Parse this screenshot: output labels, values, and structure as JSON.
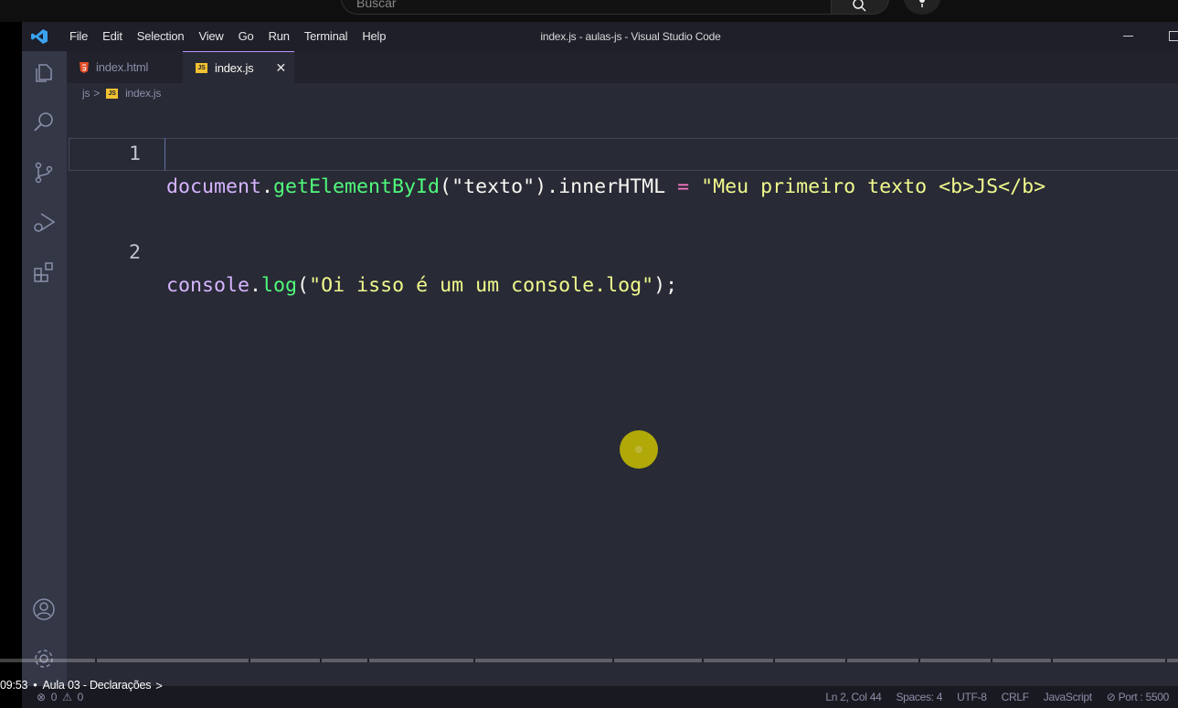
{
  "youtube": {
    "search_placeholder": "Buscar",
    "chapter_time": "09:53",
    "chapter_bullet": "•",
    "chapter_title": "Aula 03 - Declarações",
    "chapter_chevron": ">"
  },
  "window": {
    "title": "index.js - aulas-js - Visual Studio Code"
  },
  "menu": [
    "File",
    "Edit",
    "Selection",
    "View",
    "Go",
    "Run",
    "Terminal",
    "Help"
  ],
  "tabs": [
    {
      "label": "index.html",
      "icon": "html5-icon",
      "active": false
    },
    {
      "label": "index.js",
      "icon": "js-icon",
      "active": true,
      "close": "✕"
    }
  ],
  "breadcrumb": {
    "folder": "js",
    "separator": ">",
    "file": "index.js",
    "file_icon_text": "JS"
  },
  "editor": {
    "lines": [
      {
        "number": "1",
        "tokens": {
          "obj": "document",
          "dot1": ".",
          "fn": "getElementById",
          "p1": "(",
          "arg": "\"texto\"",
          "p2": ").innerHTML ",
          "op": "=",
          "sp": " ",
          "str": "\"Meu primeiro texto <b>JS</b>"
        }
      },
      {
        "number": "2",
        "tokens": {
          "obj": "console",
          "dot1": ".",
          "fn": "log",
          "p1": "(",
          "str": "\"Oi isso é um um console.log\"",
          "p2": ");"
        }
      }
    ]
  },
  "status": {
    "errors": "0",
    "warnings": "0",
    "position": "Ln 2, Col 44",
    "spaces": "Spaces: 4",
    "encoding": "UTF-8",
    "eol": "CRLF",
    "language": "JavaScript",
    "port": "Port : 5500"
  },
  "colors": {
    "editor_bg": "#282a36",
    "accent": "#bd93f9",
    "string": "#f1fa8c",
    "function": "#50fa7b",
    "operator": "#ff79c6"
  }
}
